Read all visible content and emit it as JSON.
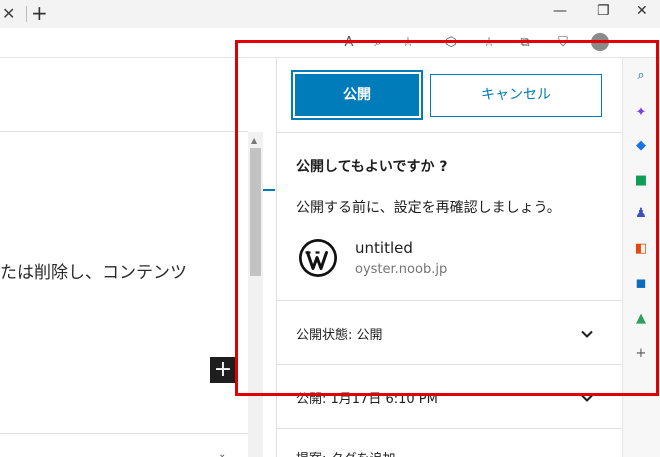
{
  "editor": {
    "paragraph_text": "たは削除し、コンテンツ",
    "add_block_symbol": "+"
  },
  "publish_panel": {
    "publish_button": "公開",
    "cancel_button": "キャンセル",
    "confirm_title": "公開してもよいですか ?",
    "confirm_desc": "公開する前に、設定を再確認しましょう。",
    "site": {
      "name": "untitled",
      "url": "oyster.noob.jp"
    },
    "rows": [
      {
        "label": "公開状態: 公開"
      },
      {
        "label": "公開: 1月17日 6:10 PM"
      },
      {
        "label": "提案: タグを追加"
      }
    ]
  },
  "browser": {
    "tab_close": "✕",
    "new_tab": "+",
    "window_controls": [
      "minimize",
      "restore",
      "close"
    ],
    "toolbar_icons": [
      "read-aloud-icon",
      "zoom-icon",
      "favorite-add-icon",
      "extensions-icon",
      "favorites-icon",
      "collections-icon",
      "browser-essentials-icon",
      "profile-icon"
    ]
  },
  "edge_sidebar": {
    "icons": [
      "search-icon",
      "copilot-icon",
      "shopping-icon",
      "tools-icon",
      "games-icon",
      "office-icon",
      "outlook-icon",
      "drop-icon",
      "add-icon"
    ],
    "colors": {
      "search": "#1a5fd1",
      "copilot": "#7b3fe4",
      "shopping": "#1a73e8",
      "tools": "#0f9d58",
      "games": "#3b4ec2",
      "office": "#e8450a",
      "outlook": "#0f6cbd",
      "drop": "#2e9e5b"
    }
  },
  "colors": {
    "accent": "#007cba",
    "annotation": "#e00000"
  }
}
